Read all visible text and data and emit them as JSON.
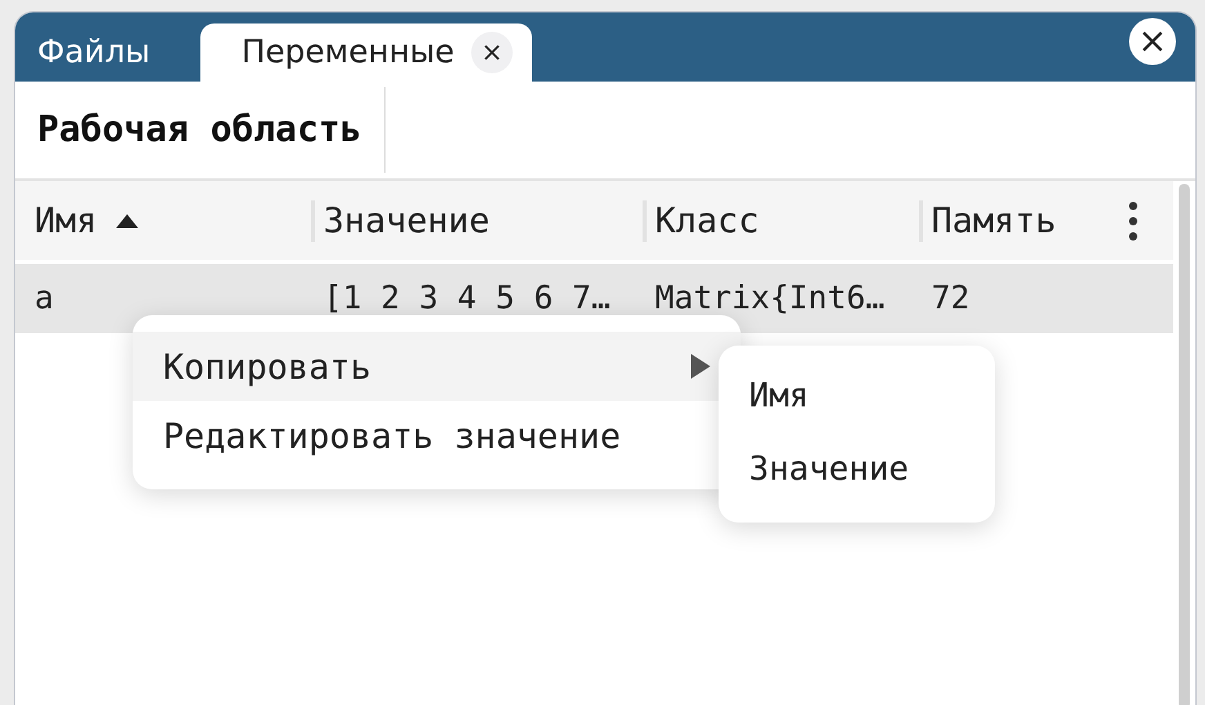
{
  "tabs": [
    {
      "label": "Файлы",
      "selected": false,
      "closable": false
    },
    {
      "label": "Переменные",
      "selected": true,
      "closable": true
    }
  ],
  "toolbar": {
    "title": "Рабочая область"
  },
  "table": {
    "columns": [
      {
        "label": "Имя",
        "sorted_ascending": true
      },
      {
        "label": "Значение",
        "sorted_ascending": false
      },
      {
        "label": "Класс",
        "sorted_ascending": false
      },
      {
        "label": "Память",
        "sorted_ascending": false
      }
    ],
    "rows": [
      {
        "cells": [
          "a",
          "[1 2 3 4 5 6 7…",
          "Matrix{Int6…",
          "72"
        ],
        "selected": true
      }
    ]
  },
  "context_menu": {
    "items": [
      {
        "label": "Копировать",
        "selected": true,
        "submenu": true
      },
      {
        "label": "Редактировать значение",
        "selected": false,
        "submenu": false
      }
    ]
  },
  "submenu": {
    "items": [
      {
        "label": "Имя",
        "selected": false
      },
      {
        "label": "Значение",
        "selected": false
      }
    ]
  }
}
